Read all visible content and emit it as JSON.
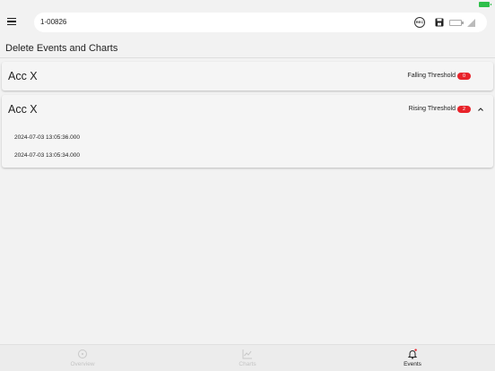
{
  "header": {
    "device_name": "1-00826",
    "rec_label": "REC"
  },
  "page": {
    "title": "Delete Events and Charts"
  },
  "cards": [
    {
      "title": "Acc X",
      "label": "Falling Threshold",
      "badge": "0",
      "expanded": false
    },
    {
      "title": "Acc X",
      "label": "Rising Threshold",
      "badge": "2",
      "expanded": true,
      "events": [
        "2024-07-03 13:05:36.000",
        "2024-07-03 13:05:34.000"
      ]
    }
  ],
  "tabs": [
    {
      "label": "Overview",
      "active": false
    },
    {
      "label": "Charts",
      "active": false
    },
    {
      "label": "Events",
      "active": true
    }
  ],
  "colors": {
    "badge": "#e8232a",
    "battery": "#2fbf4a"
  }
}
